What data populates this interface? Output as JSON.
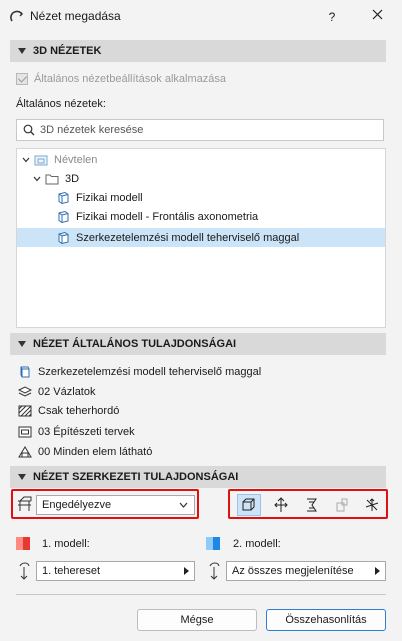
{
  "window": {
    "title": "Nézet megadása",
    "help_label": "?",
    "close_label": "✕"
  },
  "section_3d": {
    "header": "3D NÉZETEK",
    "apply_general_checkbox": "Általános nézetbeállítások alkalmazása",
    "general_views_label": "Általános nézetek:",
    "search_placeholder": "3D nézetek keresése",
    "tree": [
      {
        "label": "Névtelen",
        "icon": "project-icon",
        "expanded": true
      },
      {
        "label": "3D",
        "icon": "folder-icon",
        "expanded": true
      },
      {
        "label": "Fizikai modell",
        "icon": "3d-view-icon"
      },
      {
        "label": "Fizikai modell - Frontális axonometria",
        "icon": "3d-view-icon"
      },
      {
        "label": "Szerkezetelemzési modell teherviselő maggal",
        "icon": "3d-view-icon",
        "selected": true
      }
    ]
  },
  "section_general": {
    "header": "NÉZET ÁLTALÁNOS TULAJDONSÁGAI",
    "props": [
      {
        "label": "Szerkezetelemzési modell teherviselő maggal",
        "icon": "view-icon"
      },
      {
        "label": "02 Vázlatok",
        "icon": "layer-combination-icon"
      },
      {
        "label": "Csak teherhordó",
        "icon": "structural-filter-icon"
      },
      {
        "label": "03 Építészeti tervek",
        "icon": "pen-set-icon"
      },
      {
        "label": "00 Minden elem látható",
        "icon": "model-view-options-icon"
      }
    ]
  },
  "section_structural": {
    "header": "NÉZET SZERKEZETI TULAJDONSÁGAI",
    "mode_select_value": "Engedélyezve",
    "model1_label": "1. modell:",
    "model2_label": "2. modell:",
    "model1_dropdown": "1. tehereset",
    "model2_dropdown": "Az összes megjelenítése",
    "colors": {
      "model1": "#e53935",
      "model2": "#1e88e5"
    }
  },
  "buttons": {
    "cancel": "Mégse",
    "compare": "Összehasonlítás"
  }
}
